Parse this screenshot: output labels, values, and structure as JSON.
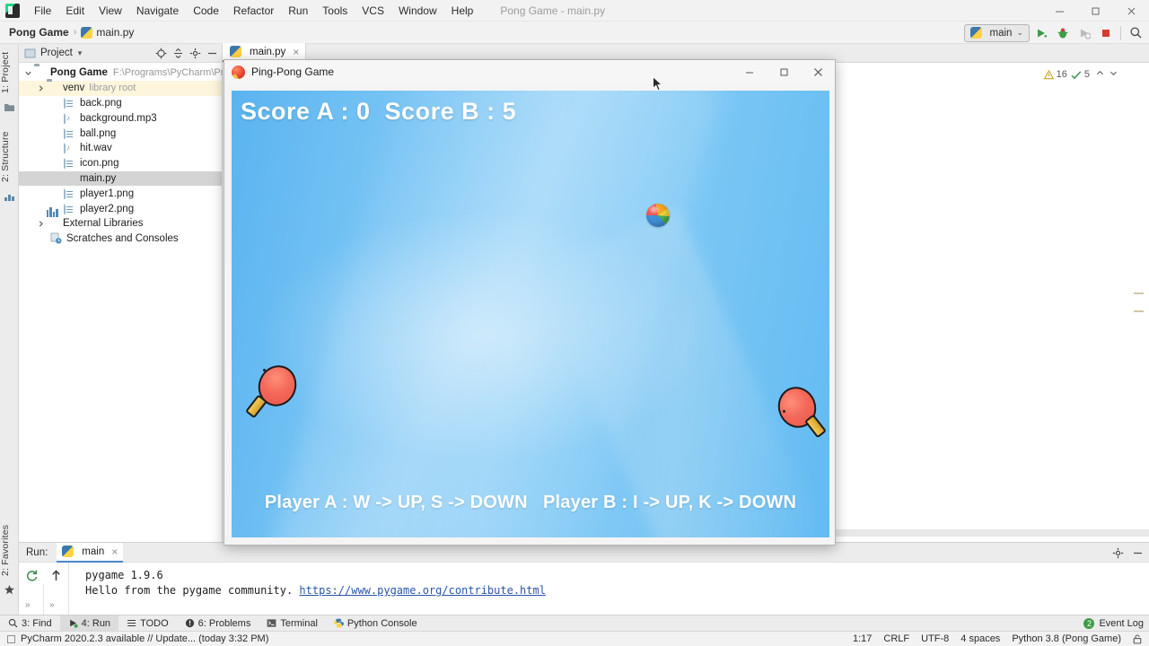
{
  "window": {
    "title": "Pong Game - main.py",
    "logo_icon": "pycharm-logo-icon",
    "minimize_icon": "minimize-icon",
    "maximize_icon": "maximize-icon",
    "close_icon": "close-icon"
  },
  "menu": {
    "items": [
      {
        "label": "File"
      },
      {
        "label": "Edit"
      },
      {
        "label": "View"
      },
      {
        "label": "Navigate"
      },
      {
        "label": "Code"
      },
      {
        "label": "Refactor"
      },
      {
        "label": "Run"
      },
      {
        "label": "Tools"
      },
      {
        "label": "VCS"
      },
      {
        "label": "Window"
      },
      {
        "label": "Help"
      }
    ]
  },
  "navbar": {
    "project_crumb": "Pong Game",
    "separator": "›",
    "file_crumb": "main.py",
    "run_config": "main",
    "run_config_chevron": "⌄",
    "buttons": [
      {
        "name": "run-button",
        "icon": "run-icon"
      },
      {
        "name": "debug-button",
        "icon": "bug-icon"
      },
      {
        "name": "coverage-button",
        "icon": "coverage-icon"
      },
      {
        "name": "stop-button",
        "icon": "stop-icon"
      },
      {
        "name": "search-everywhere-button",
        "icon": "search-icon"
      }
    ]
  },
  "left_strip": {
    "top_items": [
      {
        "label": "1: Project",
        "icon": "project-icon"
      },
      {
        "label": "2: Structure",
        "icon": "structure-icon"
      }
    ],
    "bottom_items": [
      {
        "label": "2: Favorites",
        "icon": "star-icon"
      }
    ]
  },
  "project_panel": {
    "title": "Project",
    "title_chevron": "▾",
    "toolbar": [
      {
        "name": "select-opened-file-button",
        "icon": "target-icon"
      },
      {
        "name": "collapse-all-button",
        "icon": "collapse-all-icon"
      },
      {
        "name": "settings-button",
        "icon": "gear-icon"
      },
      {
        "name": "hide-button",
        "icon": "minimize-icon"
      }
    ],
    "tree": [
      {
        "name": "tree-item-pong-game",
        "label": "Pong Game",
        "note": "F:\\Programs\\PyCharm\\Projects\\",
        "icon": "folder-icon",
        "arrow": "expanded",
        "indent": 0,
        "bold": true,
        "state": "normal"
      },
      {
        "name": "tree-item-venv",
        "label": "venv",
        "note": "library root",
        "icon": "folder-icon",
        "arrow": "collapsed",
        "indent": 1,
        "bold": false,
        "state": "highlight"
      },
      {
        "name": "tree-item-back-png",
        "label": "back.png",
        "note": "",
        "icon": "image-file-icon",
        "arrow": "none",
        "indent": 2,
        "bold": false,
        "state": "normal"
      },
      {
        "name": "tree-item-background-mp3",
        "label": "background.mp3",
        "note": "",
        "icon": "audio-file-icon",
        "arrow": "none",
        "indent": 2,
        "bold": false,
        "state": "normal"
      },
      {
        "name": "tree-item-ball-png",
        "label": "ball.png",
        "note": "",
        "icon": "image-file-icon",
        "arrow": "none",
        "indent": 2,
        "bold": false,
        "state": "normal"
      },
      {
        "name": "tree-item-hit-wav",
        "label": "hit.wav",
        "note": "",
        "icon": "audio-file-icon",
        "arrow": "none",
        "indent": 2,
        "bold": false,
        "state": "normal"
      },
      {
        "name": "tree-item-icon-png",
        "label": "icon.png",
        "note": "",
        "icon": "image-file-icon",
        "arrow": "none",
        "indent": 2,
        "bold": false,
        "state": "normal"
      },
      {
        "name": "tree-item-main-py",
        "label": "main.py",
        "note": "",
        "icon": "python-file-icon",
        "arrow": "none",
        "indent": 2,
        "bold": false,
        "state": "selected"
      },
      {
        "name": "tree-item-player1-png",
        "label": "player1.png",
        "note": "",
        "icon": "image-file-icon",
        "arrow": "none",
        "indent": 2,
        "bold": false,
        "state": "normal"
      },
      {
        "name": "tree-item-player2-png",
        "label": "player2.png",
        "note": "",
        "icon": "image-file-icon",
        "arrow": "none",
        "indent": 2,
        "bold": false,
        "state": "normal"
      },
      {
        "name": "tree-item-external-libraries",
        "label": "External Libraries",
        "note": "",
        "icon": "library-icon",
        "arrow": "collapsed",
        "indent": 0,
        "bold": false,
        "state": "normal"
      },
      {
        "name": "tree-item-scratches",
        "label": "Scratches and Consoles",
        "note": "",
        "icon": "scratches-icon",
        "arrow": "none",
        "indent": 1,
        "bold": false,
        "state": "normal"
      }
    ]
  },
  "editor": {
    "tab": {
      "label": "main.py",
      "icon": "python-file-icon",
      "close": "×"
    },
    "inspector": {
      "warning_icon": "warning-triangle-icon",
      "warning_count": "16",
      "typo_icon": "typo-check-icon",
      "typo_count": "5",
      "prev_icon": "chevron-up-icon",
      "next_icon": "chevron-down-icon"
    }
  },
  "game": {
    "title": "Ping-Pong Game",
    "icon": "ping-pong-paddle-icon",
    "minimize_icon": "minimize-icon",
    "maximize_icon": "maximize-icon",
    "close_icon": "close-icon",
    "score_text": "Score A : 0  Score B : 5",
    "score_a_label": "Score A",
    "score_a": "0",
    "score_b_label": "Score B",
    "score_b": "5",
    "hint_text": "Player A : W -> UP, S -> DOWN   Player B : I -> UP, K -> DOWN",
    "sprites": {
      "ball": "beach-ball-sprite",
      "paddle_left": "player-a-paddle-sprite",
      "paddle_right": "player-b-paddle-sprite"
    },
    "colors": {
      "background_top": "#5ab4f0",
      "background_mid": "#8ccef7",
      "paddle_red": "#f4695a",
      "paddle_handle": "#e8b63e"
    }
  },
  "run_panel": {
    "label": "Run:",
    "tab": {
      "label": "main",
      "icon": "python-file-icon",
      "close": "×"
    },
    "gutter": [
      {
        "name": "rerun-button",
        "icon": "rerun-icon"
      },
      {
        "name": "scroll-up-button",
        "icon": "arrow-up-icon"
      }
    ],
    "expand_chevron": "»",
    "console": [
      {
        "text": "pygame 1.9.6",
        "link": ""
      },
      {
        "text": "Hello from the pygame community. ",
        "link": "https://www.pygame.org/contribute.html"
      }
    ],
    "header_buttons": [
      {
        "name": "settings-button",
        "icon": "gear-icon"
      },
      {
        "name": "hide-button",
        "icon": "minimize-icon"
      }
    ]
  },
  "bottom_bar": {
    "tabs": [
      {
        "name": "bottom-tab-find",
        "label": "3: Find",
        "icon": "search-icon",
        "active": false
      },
      {
        "name": "bottom-tab-run",
        "label": "4: Run",
        "icon": "run-icon",
        "active": true
      },
      {
        "name": "bottom-tab-todo",
        "label": "TODO",
        "icon": "todo-icon",
        "active": false
      },
      {
        "name": "bottom-tab-problems",
        "label": "6: Problems",
        "icon": "problems-icon",
        "active": false
      },
      {
        "name": "bottom-tab-terminal",
        "label": "Terminal",
        "icon": "terminal-icon",
        "active": false
      },
      {
        "name": "bottom-tab-python-console",
        "label": "Python Console",
        "icon": "python-console-icon",
        "active": false
      }
    ],
    "event_log": {
      "label": "Event Log",
      "count": "2"
    }
  },
  "status_bar": {
    "notification": "PyCharm 2020.2.3 available // Update... (today 3:32 PM)",
    "caret_position": "1:17",
    "line_separator": "CRLF",
    "encoding": "UTF-8",
    "indent": "4 spaces",
    "interpreter": "Python 3.8 (Pong Game)",
    "lock_icon": "lock-icon"
  }
}
